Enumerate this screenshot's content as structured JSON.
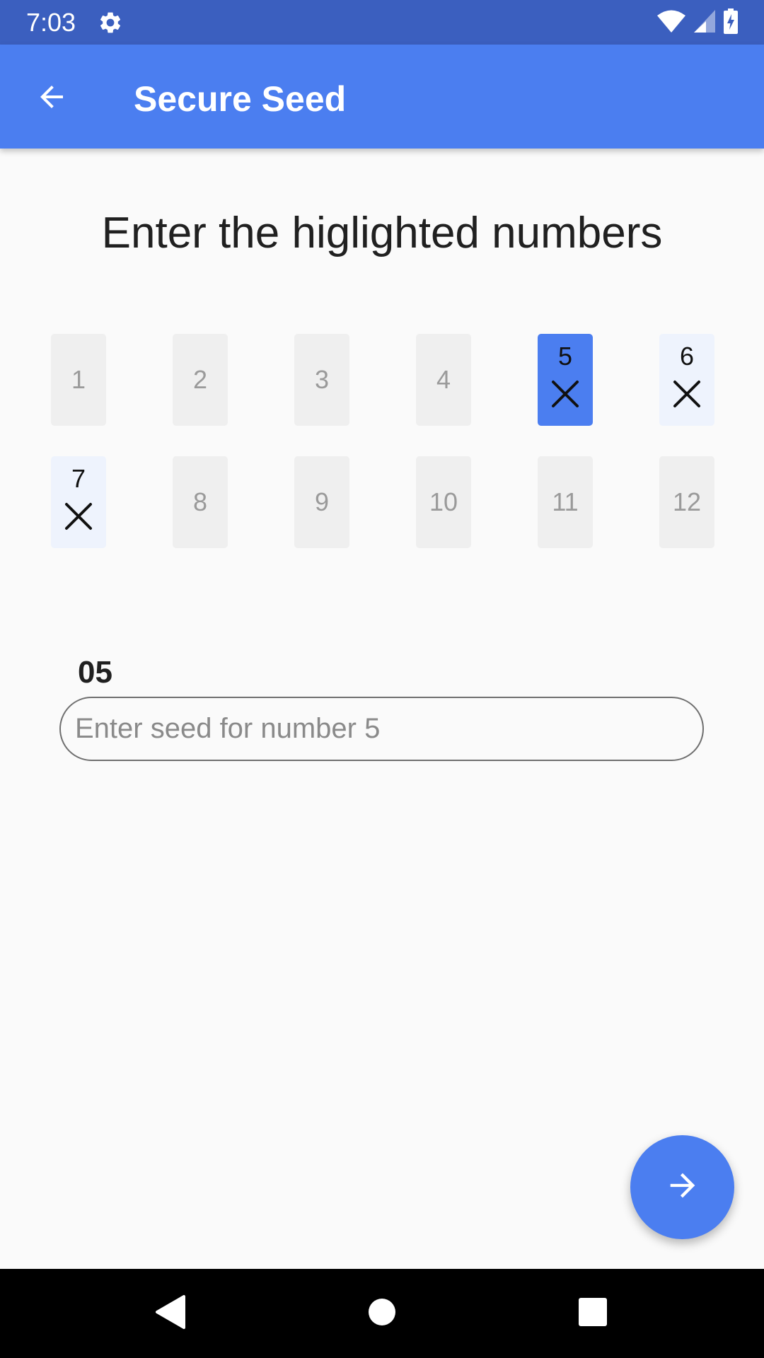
{
  "status_bar": {
    "time": "7:03"
  },
  "app_bar": {
    "title": "Secure Seed"
  },
  "instruction": "Enter the higlighted numbers",
  "grid": {
    "cells": [
      "1",
      "2",
      "3",
      "4",
      "5",
      "6",
      "7",
      "8",
      "9",
      "10",
      "11",
      "12"
    ],
    "active": "5",
    "highlighted": [
      "6",
      "7"
    ]
  },
  "seed_field": {
    "label": "05",
    "value": "",
    "placeholder": "Enter seed for number 5"
  },
  "colors": {
    "status_bar": "#3b5fbf",
    "app_bar": "#4b7ef0",
    "accent": "#4b7ef0",
    "highlight_bg": "#eef3fd",
    "cell_bg": "#efefef"
  }
}
